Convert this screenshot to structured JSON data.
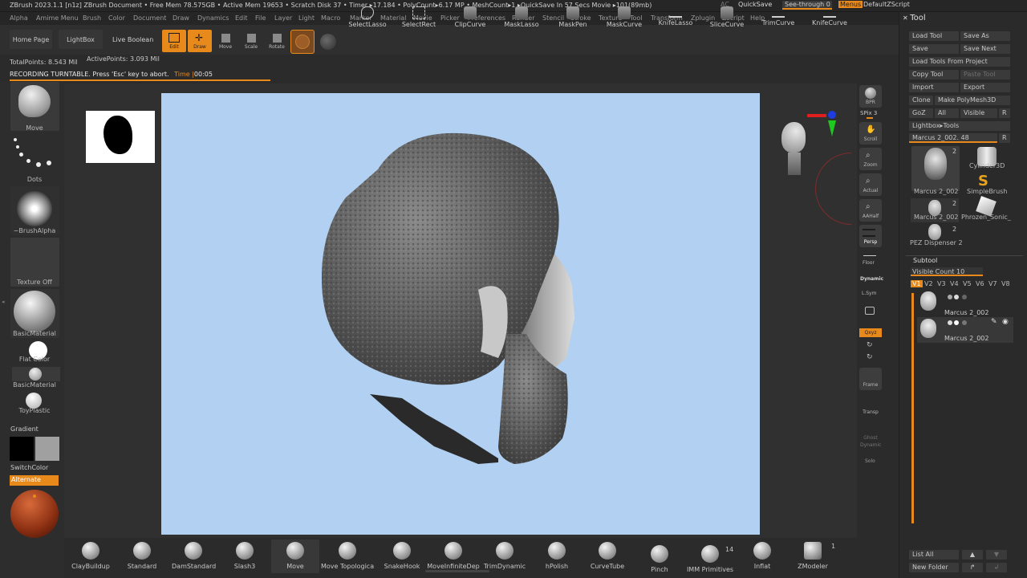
{
  "title_bar": {
    "text": "ZBrush 2023.1.1 [n1z]   ZBrush Document     • Free Mem 78.575GB • Active Mem 19653 • Scratch Disk 37 •  Timer ▸17.184 • PolyCount▸6.17 MP • MeshCount▸1   ▸QuickSave In 57 Secs Movie ▸101(89mb)",
    "ac": "AC",
    "quicksave": "QuickSave",
    "see_through": "See-through  0",
    "menus": "Menus",
    "default_zscript": "DefaultZScript"
  },
  "menu": [
    "Alpha",
    "Amime Menu",
    "Brush",
    "Color",
    "Document",
    "Draw",
    "Dynamics",
    "Edit",
    "File",
    "Layer",
    "Light",
    "Macro",
    "Marker",
    "Material",
    "Movie",
    "Picker",
    "Preferences",
    "Render",
    "Stencil",
    "Stroke",
    "Texture",
    "Tool",
    "Transform",
    "Zplugin",
    "Zscript",
    "Help"
  ],
  "toolbar": {
    "home_page": "Home Page",
    "lightbox": "LightBox",
    "live_boolean": "Live Boolean",
    "edit": "Edit",
    "draw": "Draw",
    "move": "Move",
    "scale": "Scale",
    "rotate": "Rotate",
    "tools": [
      "SelectLasso",
      "SelectRect",
      "ClipCurve",
      "MaskLasso",
      "MaskPen",
      "MaskCurve",
      "KnifeLasso",
      "SliceCurve",
      "TrimCurve",
      "KnifeCurve"
    ]
  },
  "info": {
    "total_points": "TotalPoints: 8.543 Mil",
    "active_points": "ActivePoints: 3.093 Mil",
    "recording": "RECORDING TURNTABLE. Press 'Esc' key to abort.",
    "time_label": "Time",
    "time_value": "00:05"
  },
  "left_panel": {
    "move": "Move",
    "dots": "Dots",
    "brush_alpha": "~BrushAlpha",
    "texture_off": "Texture Off",
    "basic_material": "BasicMaterial",
    "flat_color": "Flat Color",
    "basic_material_2": "BasicMaterial",
    "toy_plastic": "ToyPlastic",
    "gradient": "Gradient",
    "switch_color": "SwitchColor",
    "alternate": "Alternate",
    "main_color": "#000000",
    "secondary_color": "#a0a0a0"
  },
  "right_shelf": {
    "bpr": "BPR",
    "spix": "SPix 3",
    "scroll": "Scroll",
    "zoom": "Zoom",
    "actual": "Actual",
    "aahalf": "AAHalf",
    "persp": "Persp",
    "floor": "Floor",
    "dynamic": "Dynamic",
    "lsym": "L.Sym",
    "xyz": "Qxyz",
    "frame": "Frame",
    "transp": "Transp",
    "ghost": "Ghost",
    "dynamic_solo": "Dynamic",
    "solo": "Solo"
  },
  "tool_panel": {
    "title": "Tool",
    "load_tool": "Load Tool",
    "save_as": "Save As",
    "save": "Save",
    "save_next": "Save Next",
    "load_tools_from_project": "Load Tools From Project",
    "copy_tool": "Copy Tool",
    "paste_tool": "Paste Tool",
    "import": "Import",
    "export": "Export",
    "clone": "Clone",
    "make_polymesh": "Make PolyMesh3D",
    "goz": "GoZ",
    "all": "All",
    "visible": "Visible",
    "r": "R",
    "lightbox_tools": "Lightbox▸Tools",
    "current_tool": "Marcus 2_002. 48",
    "r2": "R",
    "thumbs": [
      {
        "label": "Marcus 2_002",
        "count": "2"
      },
      {
        "label": "Cylinder3D",
        "count": ""
      },
      {
        "label": "SimpleBrush",
        "count": ""
      },
      {
        "label": "Marcus 2_002",
        "count": "2"
      },
      {
        "label": "Phrozen_Sonic_M",
        "count": ""
      },
      {
        "label": "PEZ Dispenser 2",
        "count": "2"
      }
    ],
    "subtool": "Subtool",
    "visible_count": "Visible Count 10",
    "vtabs": [
      "V1",
      "V2",
      "V3",
      "V4",
      "V5",
      "V6",
      "V7",
      "V8"
    ],
    "subtools": [
      "Marcus 2_002",
      "Marcus 2_002"
    ],
    "list_all": "List All",
    "new_folder": "New Folder"
  },
  "bottom_bar": {
    "brushes": [
      "ClayBuildup",
      "Standard",
      "DamStandard",
      "Slash3",
      "Move",
      "Move Topologica",
      "SnakeHook",
      "MoveInfiniteDep",
      "TrimDynamic",
      "hPolish",
      "CurveTube",
      "Pinch",
      "IMM Primitives",
      "Inflat",
      "ZModeler"
    ],
    "imm_count": "14",
    "zmodeler_count": "1"
  }
}
